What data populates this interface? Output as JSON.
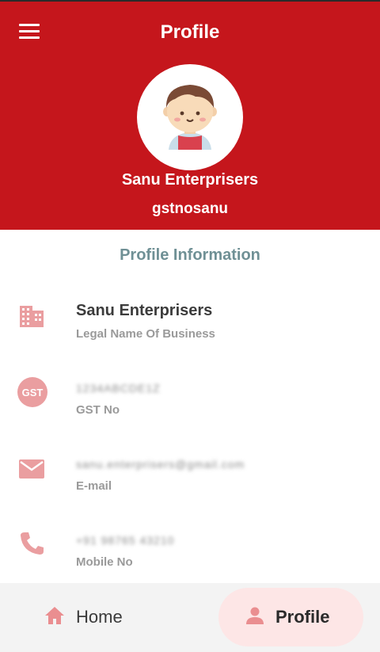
{
  "header": {
    "title": "Profile",
    "business_name": "Sanu Enterprisers",
    "gst_username": "gstnosanu"
  },
  "section_title": "Profile Information",
  "fields": [
    {
      "icon": "building-icon",
      "value": "Sanu Enterprisers",
      "label": "Legal Name Of Business"
    },
    {
      "icon": "gst-icon",
      "icon_text": "GST",
      "value": "1234ABCDE1Z",
      "label": "GST No"
    },
    {
      "icon": "email-icon",
      "value": "sanu.enterprisers@gmail.com",
      "label": "E-mail"
    },
    {
      "icon": "phone-icon",
      "value": "+91 98765 43210",
      "label": "Mobile No"
    }
  ],
  "bottom_nav": {
    "home_label": "Home",
    "profile_label": "Profile",
    "active": "Profile"
  },
  "colors": {
    "header_bg": "#c5161c",
    "accent_icon": "#ea9ea0",
    "section_title": "#6f9095",
    "active_tab_bg": "#fde6e6"
  }
}
